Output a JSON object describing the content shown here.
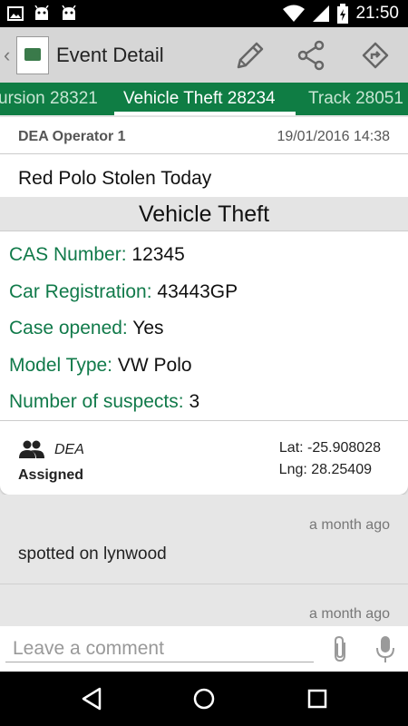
{
  "status_bar": {
    "time": "21:50",
    "icons": [
      "image-icon",
      "android-icon",
      "android-icon",
      "wifi-icon",
      "signal-icon",
      "battery-charging-icon"
    ]
  },
  "action_bar": {
    "title": "Event Detail",
    "actions": [
      "edit-pencil-icon",
      "share-icon",
      "directions-icon"
    ]
  },
  "tabs": [
    {
      "label": "ursion 28321",
      "active": false
    },
    {
      "label": "Vehicle Theft 28234",
      "active": true
    },
    {
      "label": "Track 28051",
      "active": false
    }
  ],
  "event": {
    "operator": "DEA Operator 1",
    "datetime": "19/01/2016 14:38",
    "headline": "Red Polo Stolen Today",
    "category": "Vehicle Theft",
    "fields": [
      {
        "key": "CAS Number:",
        "value": "12345"
      },
      {
        "key": "Car Registration:",
        "value": "43443GP"
      },
      {
        "key": "Case opened:",
        "value": "Yes"
      },
      {
        "key": "Model Type:",
        "value": "VW Polo"
      },
      {
        "key": "Number of suspects:",
        "value": "3"
      }
    ],
    "agency": "DEA",
    "status": "Assigned",
    "lat": "Lat: -25.908028",
    "lng": "Lng: 28.25409"
  },
  "comments": [
    {
      "when": "a month ago",
      "text": "spotted on lynwood"
    },
    {
      "when": "a month ago",
      "text": ""
    }
  ],
  "comment_input": {
    "placeholder": "Leave a comment"
  },
  "colors": {
    "accent_green": "#0f7d44",
    "field_key_green": "#117a4a"
  }
}
